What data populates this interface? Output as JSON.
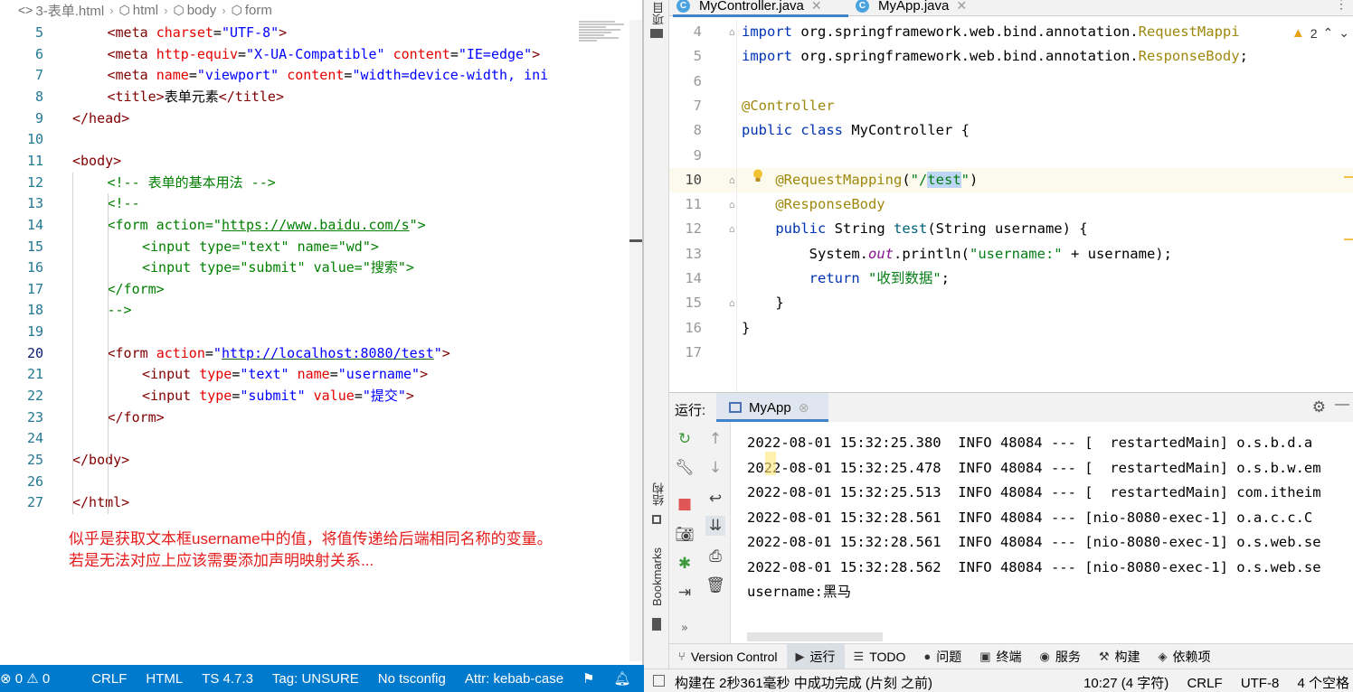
{
  "vscode": {
    "breadcrumb": [
      "3-表单.html",
      "html",
      "body",
      "form"
    ],
    "lines": [
      {
        "n": "5",
        "html": "<span class='t-tag'>&lt;meta</span> <span class='t-att'>charset</span>=<span class='t-val'>\"UTF-8\"</span><span class='t-tag'>&gt;</span>",
        "indent": 2
      },
      {
        "n": "6",
        "html": "<span class='t-tag'>&lt;meta</span> <span class='t-att'>http-equiv</span>=<span class='t-val'>\"X-UA-Compatible\"</span> <span class='t-att'>content</span>=<span class='t-val'>\"IE=edge\"</span><span class='t-tag'>&gt;</span>",
        "indent": 2
      },
      {
        "n": "7",
        "html": "<span class='t-tag'>&lt;meta</span> <span class='t-att'>name</span>=<span class='t-val'>\"viewport\"</span> <span class='t-att'>content</span>=<span class='t-val'>\"width=device-width, ini</span>",
        "indent": 2
      },
      {
        "n": "8",
        "html": "<span class='t-tag'>&lt;title&gt;</span><span class='t-txt'>表单元素</span><span class='t-tag'>&lt;/title&gt;</span>",
        "indent": 2
      },
      {
        "n": "9",
        "html": "<span class='t-tag'>&lt;/head&gt;</span>",
        "indent": 1
      },
      {
        "n": "10",
        "html": "",
        "indent": 0
      },
      {
        "n": "11",
        "html": "<span class='t-tag'>&lt;body&gt;</span>",
        "indent": 1
      },
      {
        "n": "12",
        "html": "<span class='t-cmt'>&lt;!-- 表单的基本用法 --&gt;</span>",
        "indent": 2
      },
      {
        "n": "13",
        "html": "<span class='t-cmt'>&lt;!--</span>",
        "indent": 2
      },
      {
        "n": "14",
        "html": "<span class='t-cmt'>&lt;form action=\"<span style='text-decoration:underline'>https://www.baidu.com/s</span>\"&gt;</span>",
        "indent": 2
      },
      {
        "n": "15",
        "html": "<span class='t-cmt'>&lt;input type=\"text\" name=\"wd\"&gt;</span>",
        "indent": 3
      },
      {
        "n": "16",
        "html": "<span class='t-cmt'>&lt;input type=\"submit\" value=\"搜索\"&gt;</span>",
        "indent": 3
      },
      {
        "n": "17",
        "html": "<span class='t-cmt'>&lt;/form&gt;</span>",
        "indent": 2
      },
      {
        "n": "18",
        "html": "<span class='t-cmt'>--&gt;</span>",
        "indent": 2
      },
      {
        "n": "19",
        "html": "",
        "indent": 0
      },
      {
        "n": "20",
        "html": "<span class='t-tag'>&lt;form</span> <span class='t-att'>action</span>=<span class='t-val'>\"<span class='t-url'>http://localhost:8080/test</span>\"</span><span class='t-tag'>&gt;</span>",
        "indent": 2,
        "current": true
      },
      {
        "n": "21",
        "html": "<span class='t-tag'>&lt;input</span> <span class='t-att'>type</span>=<span class='t-val'>\"text\"</span> <span class='t-att'>name</span>=<span class='t-val'>\"username\"</span><span class='t-tag'>&gt;</span>",
        "indent": 3
      },
      {
        "n": "22",
        "html": "<span class='t-tag'>&lt;input</span> <span class='t-att'>type</span>=<span class='t-val'>\"submit\"</span> <span class='t-att'>value</span>=<span class='t-val'>\"提交\"</span><span class='t-tag'>&gt;</span>",
        "indent": 3
      },
      {
        "n": "23",
        "html": "<span class='t-tag'>&lt;/form&gt;</span>",
        "indent": 2
      },
      {
        "n": "24",
        "html": "",
        "indent": 0
      },
      {
        "n": "25",
        "html": "<span class='t-tag'>&lt;/body&gt;</span>",
        "indent": 1
      },
      {
        "n": "26",
        "html": "",
        "indent": 0
      },
      {
        "n": "27",
        "html": "<span class='t-tag'>&lt;/html&gt;</span>",
        "indent": 1
      }
    ],
    "note_line1": "似乎是获取文本框username中的值，将值传递给后端相同名称的变量。",
    "note_line2": "若是无法对应上应该需要添加声明映射关系...",
    "status": {
      "problems": "⊗ 0 ⚠ 0",
      "eol": "CRLF",
      "lang": "HTML",
      "ts": "TS 4.7.3",
      "tag": "Tag: UNSURE",
      "tsconfig": "No tsconfig",
      "attr": "Attr: kebab-case"
    }
  },
  "idea": {
    "side_label_project": "项目",
    "side_label_structure": "结构",
    "side_label_bookmarks": "Bookmarks",
    "tabs": [
      {
        "label": "MyController.java",
        "active": true
      },
      {
        "label": "MyApp.java",
        "active": false
      }
    ],
    "warning_count": "2",
    "lines": [
      {
        "n": "4",
        "html": "<span class='k'>import</span> org.springframework.web.bind.annotation.<span class='ann'>RequestMappi</span>"
      },
      {
        "n": "5",
        "html": "<span class='k'>import</span> org.springframework.web.bind.annotation.<span class='ann'>ResponseBody</span>;"
      },
      {
        "n": "6",
        "html": ""
      },
      {
        "n": "7",
        "html": "<span class='ann'>@Controller</span>"
      },
      {
        "n": "8",
        "html": "<span class='k'>public class</span> <span class='cls'>MyController</span> {"
      },
      {
        "n": "9",
        "html": ""
      },
      {
        "n": "10",
        "html": "    <span class='ann'>@RequestMapping</span>(<span class='str'>\"/<span class='hl'>test</span>\"</span>)",
        "current": true
      },
      {
        "n": "11",
        "html": "    <span class='ann'>@ResponseBody</span>"
      },
      {
        "n": "12",
        "html": "    <span class='k'>public</span> String <span class='mth'>test</span>(String username) {"
      },
      {
        "n": "13",
        "html": "        System.<span class='fld'>out</span>.println(<span class='str'>\"username:\"</span> + username);"
      },
      {
        "n": "14",
        "html": "        <span class='k'>return</span> <span class='str'>\"收到数据\"</span>;"
      },
      {
        "n": "15",
        "html": "    }"
      },
      {
        "n": "16",
        "html": "}"
      },
      {
        "n": "17",
        "html": ""
      }
    ],
    "run": {
      "label": "运行:",
      "tab": "MyApp",
      "console": [
        "2022-08-01 15:32:25.380  INFO 48084 --- [  restartedMain] o.s.b.d.a",
        "2022-08-01 15:32:25.478  INFO 48084 --- [  restartedMain] o.s.b.w.em",
        "2022-08-01 15:32:25.513  INFO 48084 --- [  restartedMain] com.itheim",
        "2022-08-01 15:32:28.561  INFO 48084 --- [nio-8080-exec-1] o.a.c.c.C",
        "2022-08-01 15:32:28.561  INFO 48084 --- [nio-8080-exec-1] o.s.web.se",
        "2022-08-01 15:32:28.562  INFO 48084 --- [nio-8080-exec-1] o.s.web.se",
        "username:黑马"
      ]
    },
    "bottom_tabs": [
      {
        "icon": "⑂",
        "label": "Version Control",
        "name": "version-control"
      },
      {
        "icon": "▶",
        "label": "运行",
        "name": "run",
        "active": true
      },
      {
        "icon": "☰",
        "label": "TODO",
        "name": "todo"
      },
      {
        "icon": "●",
        "label": "问题",
        "name": "problems"
      },
      {
        "icon": "▣",
        "label": "终端",
        "name": "terminal"
      },
      {
        "icon": "◉",
        "label": "服务",
        "name": "services"
      },
      {
        "icon": "⚒",
        "label": "构建",
        "name": "build"
      },
      {
        "icon": "◈",
        "label": "依赖项",
        "name": "dependencies"
      }
    ],
    "status": {
      "message": "构建在 2秒361毫秒 中成功完成 (片刻 之前)",
      "position": "10:27 (4 字符)",
      "eol": "CRLF",
      "encoding": "UTF-8",
      "indent": "4 个空格"
    }
  }
}
